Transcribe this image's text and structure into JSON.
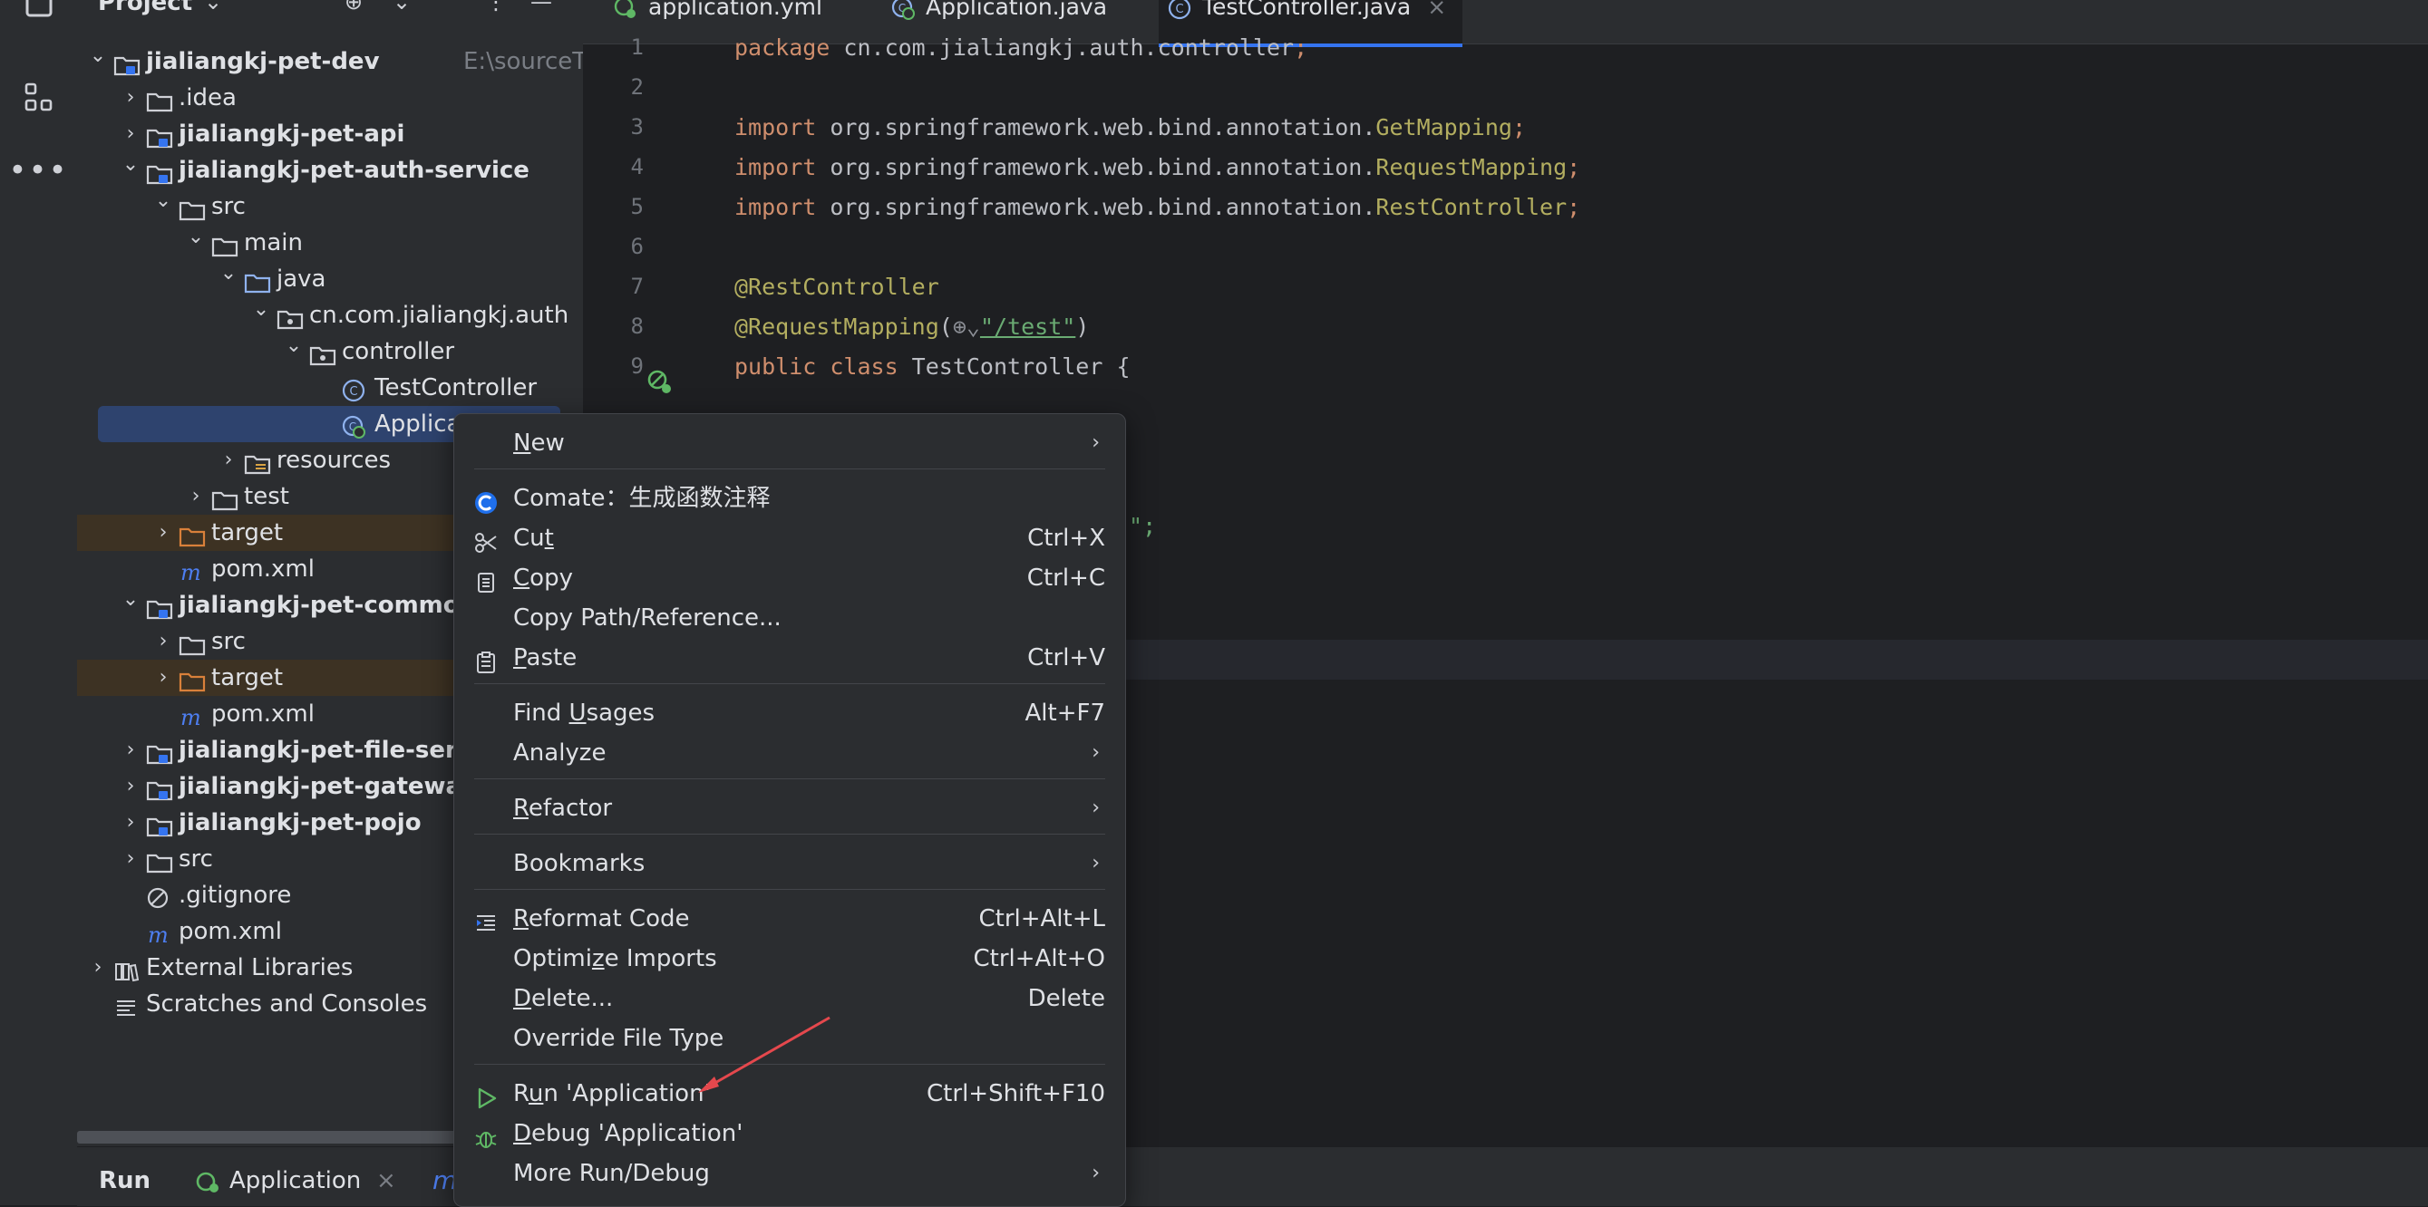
{
  "project_panel": {
    "title": "Project",
    "tree": [
      {
        "label": "jialiangkj-pet-dev",
        "path": "E:\\sourceTree\\jialia",
        "bold": true,
        "icon": "module-folder-icon",
        "depth": 0,
        "chevron": "down"
      },
      {
        "label": ".idea",
        "icon": "folder-icon",
        "depth": 1,
        "chevron": "right"
      },
      {
        "label": "jialiangkj-pet-api",
        "bold": true,
        "icon": "module-folder-icon",
        "depth": 1,
        "chevron": "right"
      },
      {
        "label": "jialiangkj-pet-auth-service",
        "bold": true,
        "icon": "module-folder-icon",
        "depth": 1,
        "chevron": "down"
      },
      {
        "label": "src",
        "icon": "folder-icon",
        "depth": 2,
        "chevron": "down"
      },
      {
        "label": "main",
        "icon": "folder-icon",
        "depth": 3,
        "chevron": "down"
      },
      {
        "label": "java",
        "icon": "source-folder-icon",
        "depth": 4,
        "chevron": "down"
      },
      {
        "label": "cn.com.jialiangkj.auth",
        "icon": "package-icon",
        "depth": 5,
        "chevron": "down"
      },
      {
        "label": "controller",
        "icon": "package-icon",
        "depth": 6,
        "chevron": "down"
      },
      {
        "label": "TestController",
        "icon": "class-icon",
        "depth": 7,
        "chevron": "none"
      },
      {
        "label": "Application",
        "icon": "spring-class-icon",
        "depth": 7,
        "chevron": "none",
        "selected": true
      },
      {
        "label": "resources",
        "icon": "resources-folder-icon",
        "depth": 4,
        "chevron": "right"
      },
      {
        "label": "test",
        "icon": "folder-icon",
        "depth": 3,
        "chevron": "right"
      },
      {
        "label": "target",
        "icon": "excluded-folder-icon",
        "depth": 2,
        "chevron": "right",
        "highlight": true
      },
      {
        "label": "pom.xml",
        "icon": "maven-icon",
        "depth": 2,
        "chevron": "none"
      },
      {
        "label": "jialiangkj-pet-common",
        "bold": true,
        "icon": "module-folder-icon",
        "depth": 1,
        "chevron": "down"
      },
      {
        "label": "src",
        "icon": "folder-icon",
        "depth": 2,
        "chevron": "right"
      },
      {
        "label": "target",
        "icon": "excluded-folder-icon",
        "depth": 2,
        "chevron": "right",
        "highlight": true
      },
      {
        "label": "pom.xml",
        "icon": "maven-icon",
        "depth": 2,
        "chevron": "none"
      },
      {
        "label": "jialiangkj-pet-file-serv",
        "bold": true,
        "icon": "module-folder-icon",
        "depth": 1,
        "chevron": "right"
      },
      {
        "label": "jialiangkj-pet-gateway",
        "bold": true,
        "icon": "module-folder-icon",
        "depth": 1,
        "chevron": "right"
      },
      {
        "label": "jialiangkj-pet-pojo",
        "bold": true,
        "icon": "module-folder-icon",
        "depth": 1,
        "chevron": "right"
      },
      {
        "label": "src",
        "icon": "folder-icon",
        "depth": 1,
        "chevron": "right"
      },
      {
        "label": ".gitignore",
        "icon": "ignore-icon",
        "depth": 1,
        "chevron": "none"
      },
      {
        "label": "pom.xml",
        "icon": "maven-icon",
        "depth": 1,
        "chevron": "none"
      },
      {
        "label": "External Libraries",
        "icon": "libraries-icon",
        "depth": 0,
        "chevron": "right"
      },
      {
        "label": "Scratches and Consoles",
        "icon": "scratches-icon",
        "depth": 0,
        "chevron": "none"
      }
    ]
  },
  "editor_tabs": [
    {
      "label": "application.yml",
      "icon": "yaml-icon"
    },
    {
      "label": "Application.java",
      "icon": "spring-class-icon"
    },
    {
      "label": "TestController.java",
      "icon": "class-icon",
      "active": true,
      "close": "×"
    }
  ],
  "code": {
    "lines": [
      {
        "n": "1",
        "html": "<span class=\"kw\">package</span> cn.com.jialiangkj.auth.controller<span class=\"kw\">;</span>"
      },
      {
        "n": "2",
        "html": ""
      },
      {
        "n": "3",
        "html": "<span class=\"kw\">import</span> org.springframework.web.bind.annotation.<span class=\"ann\">GetMapping</span><span class=\"kw\">;</span>"
      },
      {
        "n": "4",
        "html": "<span class=\"kw\">import</span> org.springframework.web.bind.annotation.<span class=\"ann\">RequestMapping</span><span class=\"kw\">;</span>"
      },
      {
        "n": "5",
        "html": "<span class=\"kw\">import</span> org.springframework.web.bind.annotation.<span class=\"ann\">RestController</span><span class=\"kw\">;</span>"
      },
      {
        "n": "6",
        "html": ""
      },
      {
        "n": "7",
        "html": "<span class=\"ann\">@RestController</span>"
      },
      {
        "n": "8",
        "html": "<span class=\"ann\">@RequestMapping</span>(<span style=\"color:#8c8f96\">⊕⌄</span><span class=\"str\" style=\"text-decoration:underline\">\"/test\"</span>)"
      },
      {
        "n": "9",
        "html": "<span class=\"kw\">public class</span> TestController {"
      }
    ],
    "peek_fragments": [
      {
        "text": ")",
        "line": 11
      },
      {
        "text": "!\";",
        "line": 13
      }
    ]
  },
  "context_menu": {
    "items": [
      {
        "type": "item",
        "label": "New",
        "mnemonic": "N",
        "submenu": true
      },
      {
        "type": "sep"
      },
      {
        "type": "item",
        "label": "Comate：生成函数注释",
        "icon": "comate-icon"
      },
      {
        "type": "item",
        "label": "Cut",
        "mnemonic": "t",
        "shortcut": "Ctrl+X",
        "icon": "scissors-icon"
      },
      {
        "type": "item",
        "label": "Copy",
        "mnemonic": "C",
        "shortcut": "Ctrl+C",
        "icon": "copy-icon"
      },
      {
        "type": "item",
        "label": "Copy Path/Reference..."
      },
      {
        "type": "item",
        "label": "Paste",
        "mnemonic": "P",
        "shortcut": "Ctrl+V",
        "icon": "paste-icon"
      },
      {
        "type": "sep"
      },
      {
        "type": "item",
        "label": "Find Usages",
        "mnemonic": "U",
        "shortcut": "Alt+F7"
      },
      {
        "type": "item",
        "label": "Analyze",
        "submenu": true
      },
      {
        "type": "sep"
      },
      {
        "type": "item",
        "label": "Refactor",
        "mnemonic": "R",
        "submenu": true
      },
      {
        "type": "sep"
      },
      {
        "type": "item",
        "label": "Bookmarks",
        "submenu": true
      },
      {
        "type": "sep"
      },
      {
        "type": "item",
        "label": "Reformat Code",
        "mnemonic": "R",
        "shortcut": "Ctrl+Alt+L",
        "icon": "reformat-icon"
      },
      {
        "type": "item",
        "label": "Optimize Imports",
        "mnemonic": "z",
        "shortcut": "Ctrl+Alt+O"
      },
      {
        "type": "item",
        "label": "Delete...",
        "mnemonic": "D",
        "shortcut": "Delete"
      },
      {
        "type": "item",
        "label": "Override File Type"
      },
      {
        "type": "sep"
      },
      {
        "type": "item",
        "label": "Run 'Application'",
        "mnemonic": "u",
        "shortcut": "Ctrl+Shift+F10",
        "icon": "run-icon"
      },
      {
        "type": "item",
        "label": "Debug 'Application'",
        "mnemonic": "D",
        "icon": "debug-icon"
      },
      {
        "type": "item",
        "label": "More Run/Debug",
        "submenu": true
      }
    ]
  },
  "bottom_bar": {
    "run_label": "Run",
    "tab_label": "Application",
    "close": "×"
  },
  "colors": {
    "accent": "#3574f0",
    "annotation_arrow": "#e5484d"
  }
}
